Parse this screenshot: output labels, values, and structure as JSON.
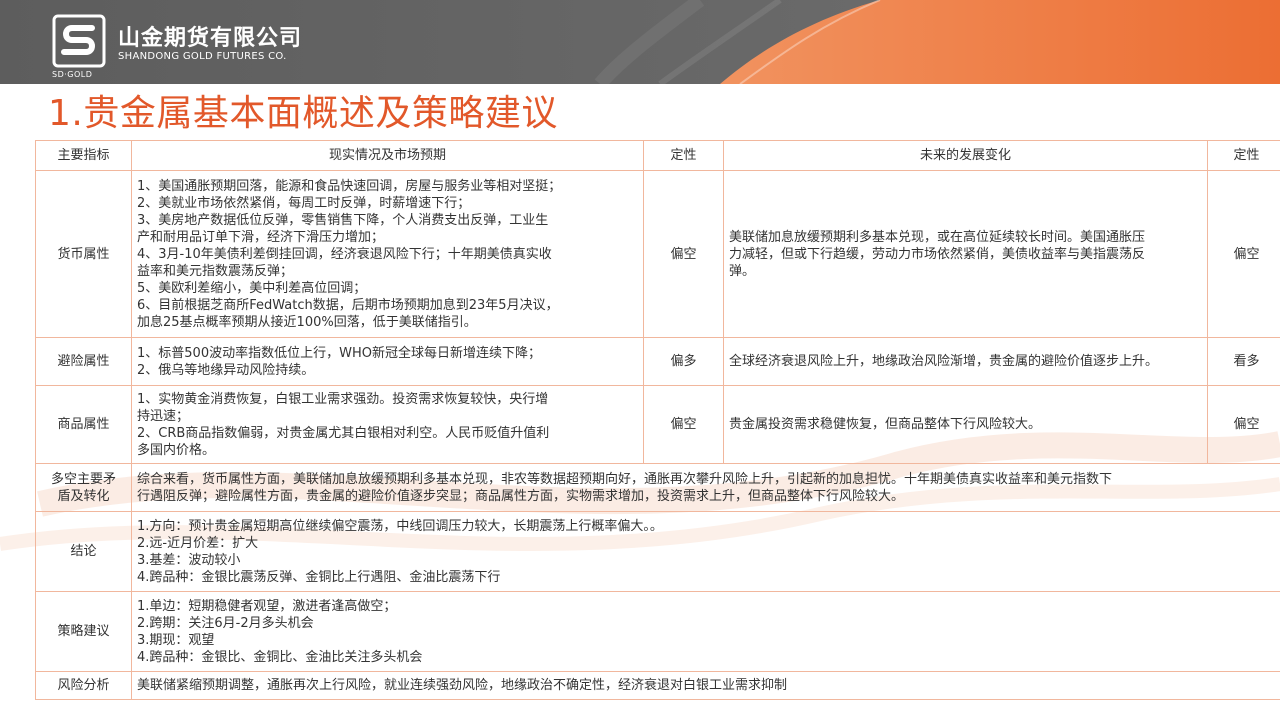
{
  "header": {
    "company_cn": "山金期货有限公司",
    "company_en": "SHANDONG GOLD FUTURES CO.",
    "logo_text": "SD·GOLD",
    "colors": {
      "dark": "#5f5f5f",
      "accent": "#ee7a44"
    }
  },
  "title": "1.贵金属基本面概述及策略建议",
  "table": {
    "headers": [
      "主要指标",
      "现实情况及市场预期",
      "定性",
      "未来的发展变化",
      "定性"
    ],
    "rows": [
      {
        "indicator": "货币属性",
        "current": [
          "1、美国通胀预期回落，能源和食品快速回调，房屋与服务业等相对坚挺；",
          "2、美就业市场依然紧俏，每周工时反弹，时薪增速下行；",
          "3、美房地产数据低位反弹，零售销售下降，个人消费支出反弹，工业生",
          "产和耐用品订单下滑，经济下滑压力增加；",
          "4、3月-10年美债利差倒挂回调，经济衰退风险下行；十年期美债真实收",
          "益率和美元指数震荡反弹；",
          "5、美欧利差缩小，美中利差高位回调；",
          "6、目前根据芝商所FedWatch数据，后期市场预期加息到23年5月决议，",
          "加息25基点概率预期从接近100%回落，低于美联储指引。"
        ],
        "q1": "偏空",
        "future": [
          "美联储加息放缓预期利多基本兑现，或在高位延续较长时间。美国通胀压",
          "力减轻，但或下行趋缓，劳动力市场依然紧俏，美债收益率与美指震荡反",
          "弹。"
        ],
        "q2": "偏空"
      },
      {
        "indicator": "避险属性",
        "current": [
          "1、标普500波动率指数低位上行，WHO新冠全球每日新增连续下降；",
          "2、俄乌等地缘异动风险持续。"
        ],
        "q1": "偏多",
        "future": [
          "全球经济衰退风险上升，地缘政治风险渐增，贵金属的避险价值逐步上升。"
        ],
        "q2": "看多"
      },
      {
        "indicator": "商品属性",
        "current": [
          "1、实物黄金消费恢复，白银工业需求强劲。投资需求恢复较快，央行增",
          "持迅速；",
          "2、CRB商品指数偏弱，对贵金属尤其白银相对利空。人民币贬值升值利",
          "多国内价格。"
        ],
        "q1": "偏空",
        "future": [
          "贵金属投资需求稳健恢复，但商品整体下行风险较大。"
        ],
        "q2": "偏空"
      }
    ],
    "summary_label": [
      "多空主要矛",
      "盾及转化"
    ],
    "summary_text": [
      "综合来看，货币属性方面，美联储加息放缓预期利多基本兑现，非农等数据超预期向好，通胀再次攀升风险上升，引起新的加息担忧。十年期美债真实收益率和美元指数下",
      "行遇阻反弹；避险属性方面，贵金属的避险价值逐步突显；商品属性方面，实物需求增加，投资需求上升，但商品整体下行风险较大。"
    ],
    "conclusion_label": "结论",
    "conclusion": [
      "1.方向：预计贵金属短期高位继续偏空震荡，中线回调压力较大，长期震荡上行概率偏大。。",
      "2.远-近月价差：扩大",
      "3.基差：波动较小",
      "4.跨品种：金银比震荡反弹、金铜比上行遇阻、金油比震荡下行"
    ],
    "strategy_label": "策略建议",
    "strategy": [
      "1.单边：短期稳健者观望，激进者逢高做空；",
      "2.跨期：关注6月-2月多头机会",
      "3.期现：观望",
      "4.跨品种：金银比、金铜比、金油比关注多头机会"
    ],
    "risk_label": "风险分析",
    "risk": "美联储紧缩预期调整，通胀再次上行风险，就业连续强劲风险，地缘政治不确定性，经济衰退对白银工业需求抑制"
  }
}
